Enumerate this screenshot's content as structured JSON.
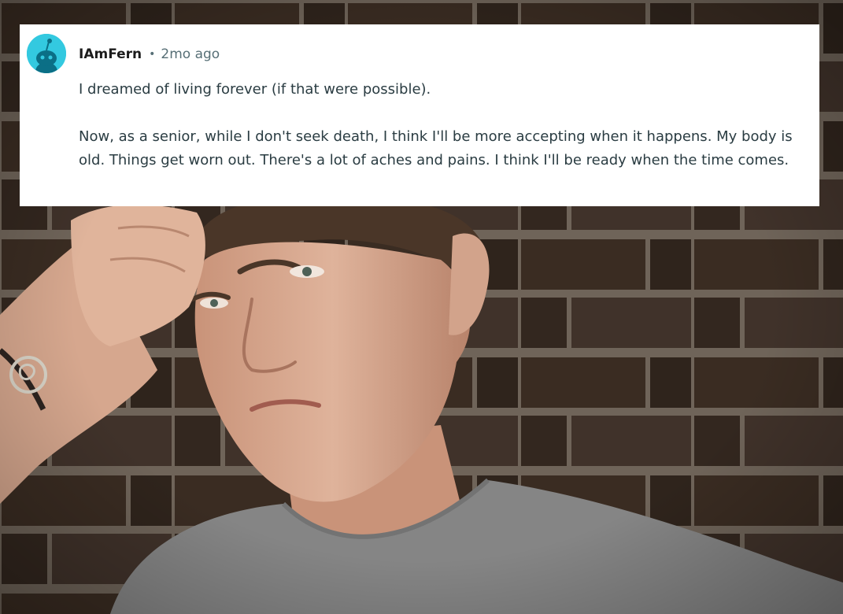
{
  "comment": {
    "avatar_icon": "reddit-snoo-avatar-icon",
    "avatar_color": "#33c9e0",
    "username": "IAmFern",
    "separator": "•",
    "timestamp": "2mo ago",
    "paragraphs": [
      "I dreamed of living forever (if that were possible).",
      "Now, as a senior, while I don't seek death, I think I'll be more accepting when it happens. My body is old. Things get worn out. There's a lot of aches and pains. I think I'll be ready when the time comes."
    ]
  },
  "background": {
    "icon": "photo-young-man-brick-wall",
    "colors": {
      "brick": "#3a2c22",
      "mortar": "#6f6459",
      "skin": "#d8ab92",
      "shirt": "#858585"
    }
  }
}
